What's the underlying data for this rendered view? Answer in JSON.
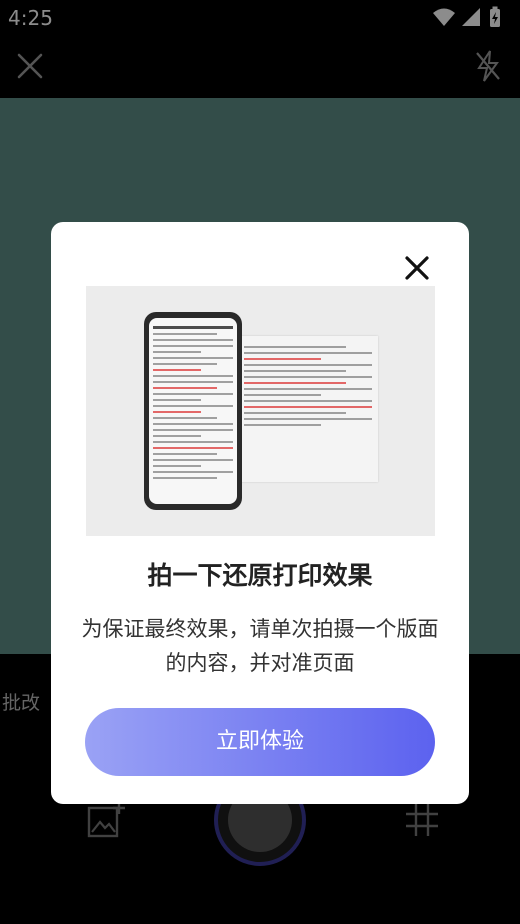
{
  "status_bar": {
    "time": "4:25"
  },
  "camera": {
    "mode_label": "批改"
  },
  "modal": {
    "title": "拍一下还原打印效果",
    "description": "为保证最终效果，请单次拍摄一个版面的内容，并对准页面",
    "cta_label": "立即体验"
  },
  "colors": {
    "camera_bg": "#5d8c85",
    "cta_start": "#9aa2f5",
    "cta_end": "#5c62ef",
    "shutter_ring": "#3b3a9a"
  }
}
